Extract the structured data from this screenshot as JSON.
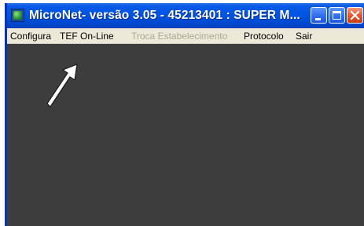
{
  "window": {
    "title": "MicroNet- versão 3.05 - 45213401 : SUPER M...",
    "icon": "app-icon"
  },
  "title_buttons": {
    "minimize": "minimize-icon",
    "maximize": "maximize-icon",
    "close": "close-icon"
  },
  "menu": {
    "items": [
      {
        "label": "Configura",
        "enabled": true
      },
      {
        "label": "TEF On-Line",
        "enabled": true
      },
      {
        "label": "Troca Estabelecimento",
        "enabled": false
      },
      {
        "label": "Protocolo",
        "enabled": true
      },
      {
        "label": "Sair",
        "enabled": true
      }
    ]
  },
  "annotation": {
    "icon": "arrow-icon",
    "color": "#ffffff"
  },
  "colors": {
    "client_background": "#3d3d3d",
    "menu_background": "#ece9d8",
    "disabled_text": "#aca899"
  }
}
